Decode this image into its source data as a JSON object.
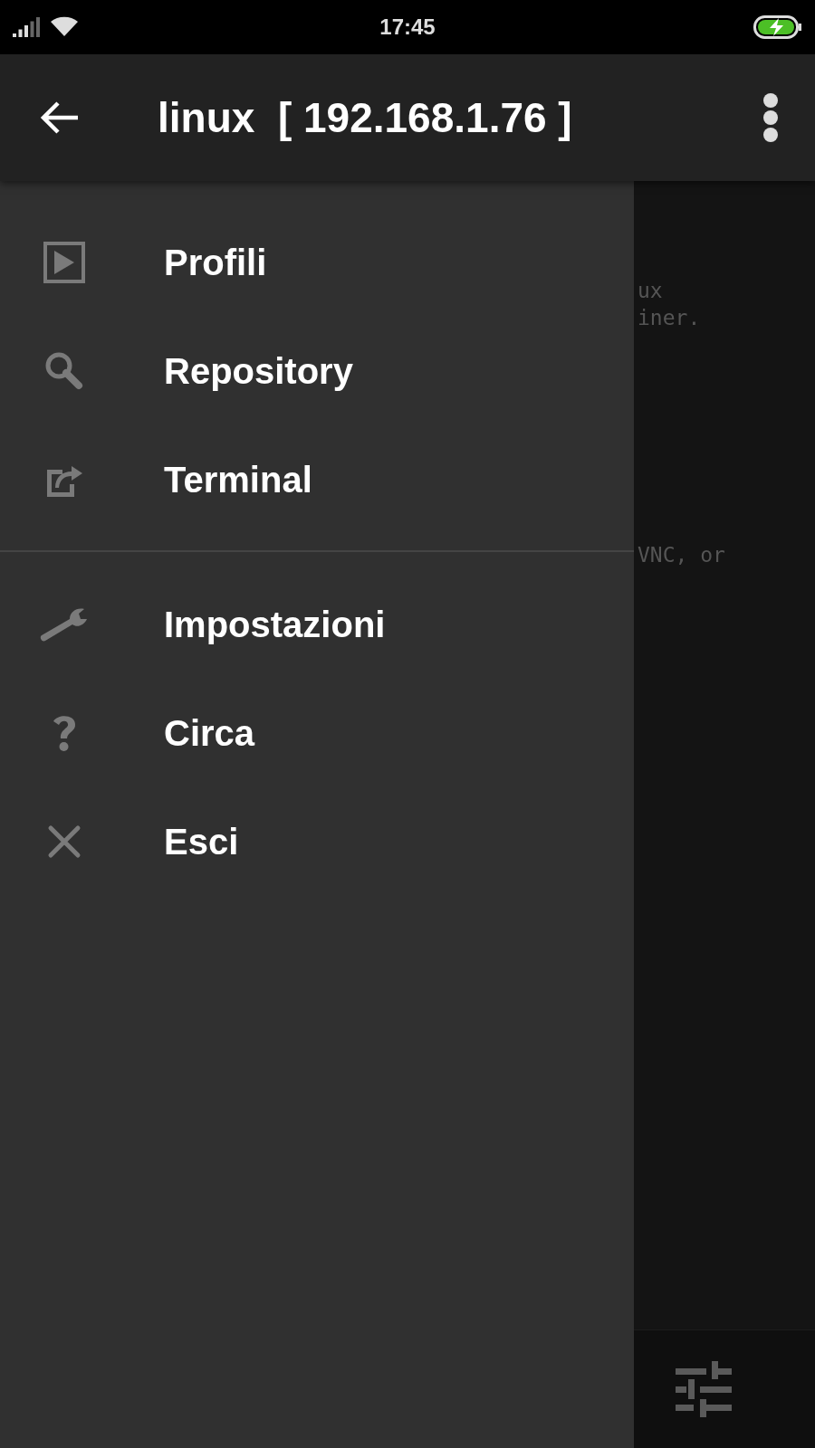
{
  "status_bar": {
    "time": "17:45"
  },
  "app_bar": {
    "title": "linux  [ 192.168.1.76 ]"
  },
  "drawer": {
    "sections": [
      {
        "items": [
          {
            "label": "Profili"
          },
          {
            "label": "Repository"
          },
          {
            "label": "Terminal"
          }
        ]
      },
      {
        "items": [
          {
            "label": "Impostazioni"
          },
          {
            "label": "Circa"
          },
          {
            "label": "Esci"
          }
        ]
      }
    ]
  },
  "background": {
    "lines": [
      "ux",
      "iner.",
      "VNC, or"
    ]
  }
}
